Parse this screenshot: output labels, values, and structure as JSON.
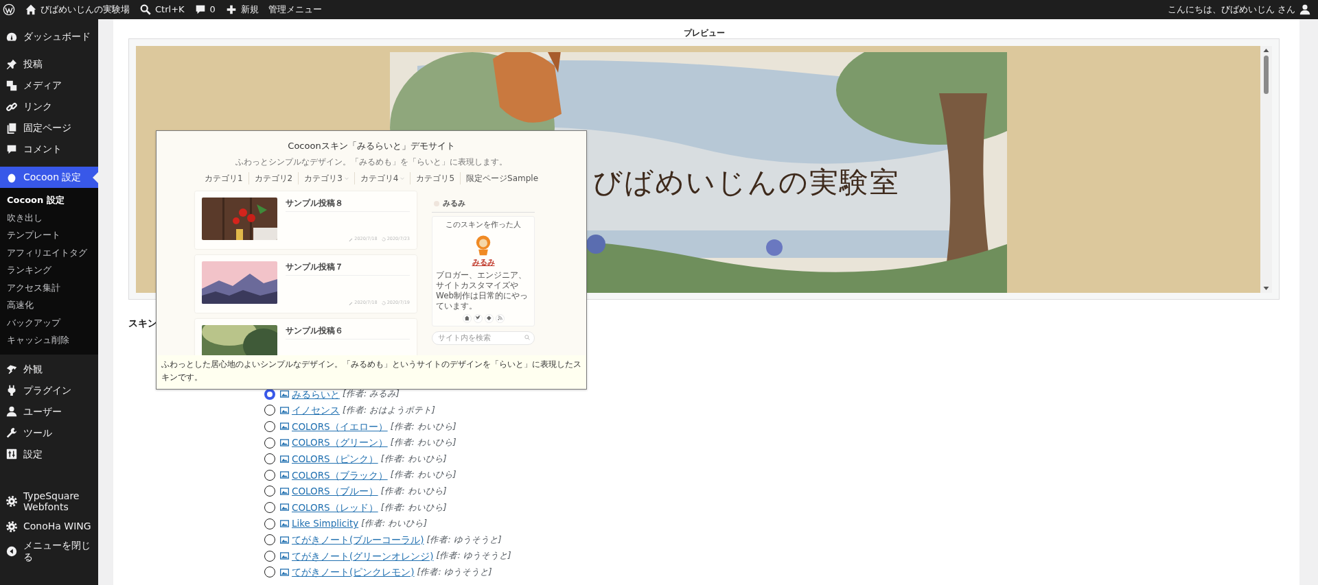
{
  "admin_bar": {
    "items": [
      {
        "kind": "logo"
      },
      {
        "kind": "home",
        "label": "びばめいじんの実験場"
      },
      {
        "kind": "search",
        "label": "Ctrl+K"
      },
      {
        "kind": "comments",
        "label": "0"
      },
      {
        "kind": "new",
        "label": "新規"
      },
      {
        "kind": "text",
        "label": "管理メニュー"
      }
    ],
    "greeting": "こんにちは、びばめいじん さん"
  },
  "sidebar": {
    "groups": [
      [
        {
          "kind": "dashboard",
          "label": "ダッシュボード",
          "selected": false
        }
      ],
      [
        {
          "kind": "pin",
          "label": "投稿",
          "selected": false
        },
        {
          "kind": "media",
          "label": "メディア",
          "selected": false
        },
        {
          "kind": "link",
          "label": "リンク",
          "selected": false
        },
        {
          "kind": "page",
          "label": "固定ページ",
          "selected": false
        },
        {
          "kind": "comment",
          "label": "コメント",
          "selected": false
        },
        {
          "kind": "cocoon",
          "label": "Cocoon 設定",
          "selected": true,
          "submenu": [
            {
              "label": "Cocoon 設定",
              "selected": true
            },
            {
              "label": "吹き出し",
              "selected": false
            },
            {
              "label": "テンプレート",
              "selected": false
            },
            {
              "label": "アフィリエイトタグ",
              "selected": false
            },
            {
              "label": "ランキング",
              "selected": false
            },
            {
              "label": "アクセス集計",
              "selected": false
            },
            {
              "label": "高速化",
              "selected": false
            },
            {
              "label": "バックアップ",
              "selected": false
            },
            {
              "label": "キャッシュ削除",
              "selected": false
            }
          ]
        }
      ],
      [
        {
          "kind": "brush",
          "label": "外観",
          "selected": false
        },
        {
          "kind": "plugin",
          "label": "プラグイン",
          "selected": false
        },
        {
          "kind": "user",
          "label": "ユーザー",
          "selected": false
        },
        {
          "kind": "wrench",
          "label": "ツール",
          "selected": false
        },
        {
          "kind": "settings",
          "label": "設定",
          "selected": false
        }
      ],
      [
        {
          "kind": "gear",
          "label": "TypeSquare Webfonts",
          "selected": false
        },
        {
          "kind": "gear",
          "label": "ConoHa WING",
          "selected": false
        },
        {
          "kind": "collapse",
          "label": "メニューを閉じる",
          "selected": false
        }
      ]
    ]
  },
  "preview": {
    "title": "プレビュー",
    "site_title": "びばめいじんの実験室"
  },
  "skin_label": "スキン",
  "tooltip": {
    "site_title": "Cocoonスキン「みるらいと」デモサイト",
    "tagline": "ふわっとシンプルなデザイン。「みるめも」を「らいと」に表現します。",
    "categories": [
      {
        "label": "カテゴリ1",
        "has_submenu": false
      },
      {
        "label": "カテゴリ2",
        "has_submenu": false
      },
      {
        "label": "カテゴリ3",
        "has_submenu": true
      },
      {
        "label": "カテゴリ4",
        "has_submenu": true
      },
      {
        "label": "カテゴリ5",
        "has_submenu": false
      },
      {
        "label": "限定ページSample",
        "has_submenu": false
      }
    ],
    "posts": [
      {
        "title": "サンプル投稿８",
        "posted": "2020/7/18",
        "updated": "2020/7/23"
      },
      {
        "title": "サンプル投稿７",
        "posted": "2020/7/18",
        "updated": "2020/7/19"
      },
      {
        "title": "サンプル投稿６"
      }
    ],
    "widget_title": "みるみ",
    "profile": {
      "heading": "このスキンを作った人",
      "name": "みるみ",
      "bio": "ブロガー、エンジニア、サイトカスタマイズやWeb制作は日常的にやっています。"
    },
    "search": {
      "placeholder": "サイト内を検索"
    },
    "description": "ふわっとした居心地のよいシンプルなデザイン。「みるめも」というサイトのデザインを「らいと」に表現したスキンです。"
  },
  "skins": [
    {
      "name": "みるらいと",
      "author_prefix": "[作者:",
      "author": "みるみ",
      "author_suffix": "]",
      "selected": true
    },
    {
      "name": "イノセンス",
      "author_prefix": "[作者:",
      "author": "おはようポテト",
      "author_suffix": "]",
      "selected": false
    },
    {
      "name": "COLORS（イエロー）",
      "author_prefix": "[作者:",
      "author": "わいひら",
      "author_suffix": "]",
      "selected": false
    },
    {
      "name": "COLORS（グリーン）",
      "author_prefix": "[作者:",
      "author": "わいひら",
      "author_suffix": "]",
      "selected": false
    },
    {
      "name": "COLORS（ピンク）",
      "author_prefix": "[作者:",
      "author": "わいひら",
      "author_suffix": "]",
      "selected": false
    },
    {
      "name": "COLORS（ブラック）",
      "author_prefix": "[作者:",
      "author": "わいひら",
      "author_suffix": "]",
      "selected": false
    },
    {
      "name": "COLORS（ブルー）",
      "author_prefix": "[作者:",
      "author": "わいひら",
      "author_suffix": "]",
      "selected": false
    },
    {
      "name": "COLORS（レッド）",
      "author_prefix": "[作者:",
      "author": "わいひら",
      "author_suffix": "]",
      "selected": false
    },
    {
      "name": "Like Simplicity",
      "author_prefix": "[作者:",
      "author": "わいひら",
      "author_suffix": "]",
      "selected": false
    },
    {
      "name": "てがきノート(ブルーコーラル)",
      "author_prefix": "[作者:",
      "author": "ゆうそうと",
      "author_suffix": "]",
      "selected": false
    },
    {
      "name": "てがきノート(グリーンオレンジ)",
      "author_prefix": "[作者:",
      "author": "ゆうそうと",
      "author_suffix": "]",
      "selected": false
    },
    {
      "name": "てがきノート(ピンクレモン)",
      "author_prefix": "[作者:",
      "author": "ゆうそうと",
      "author_suffix": "]",
      "selected": false
    }
  ]
}
